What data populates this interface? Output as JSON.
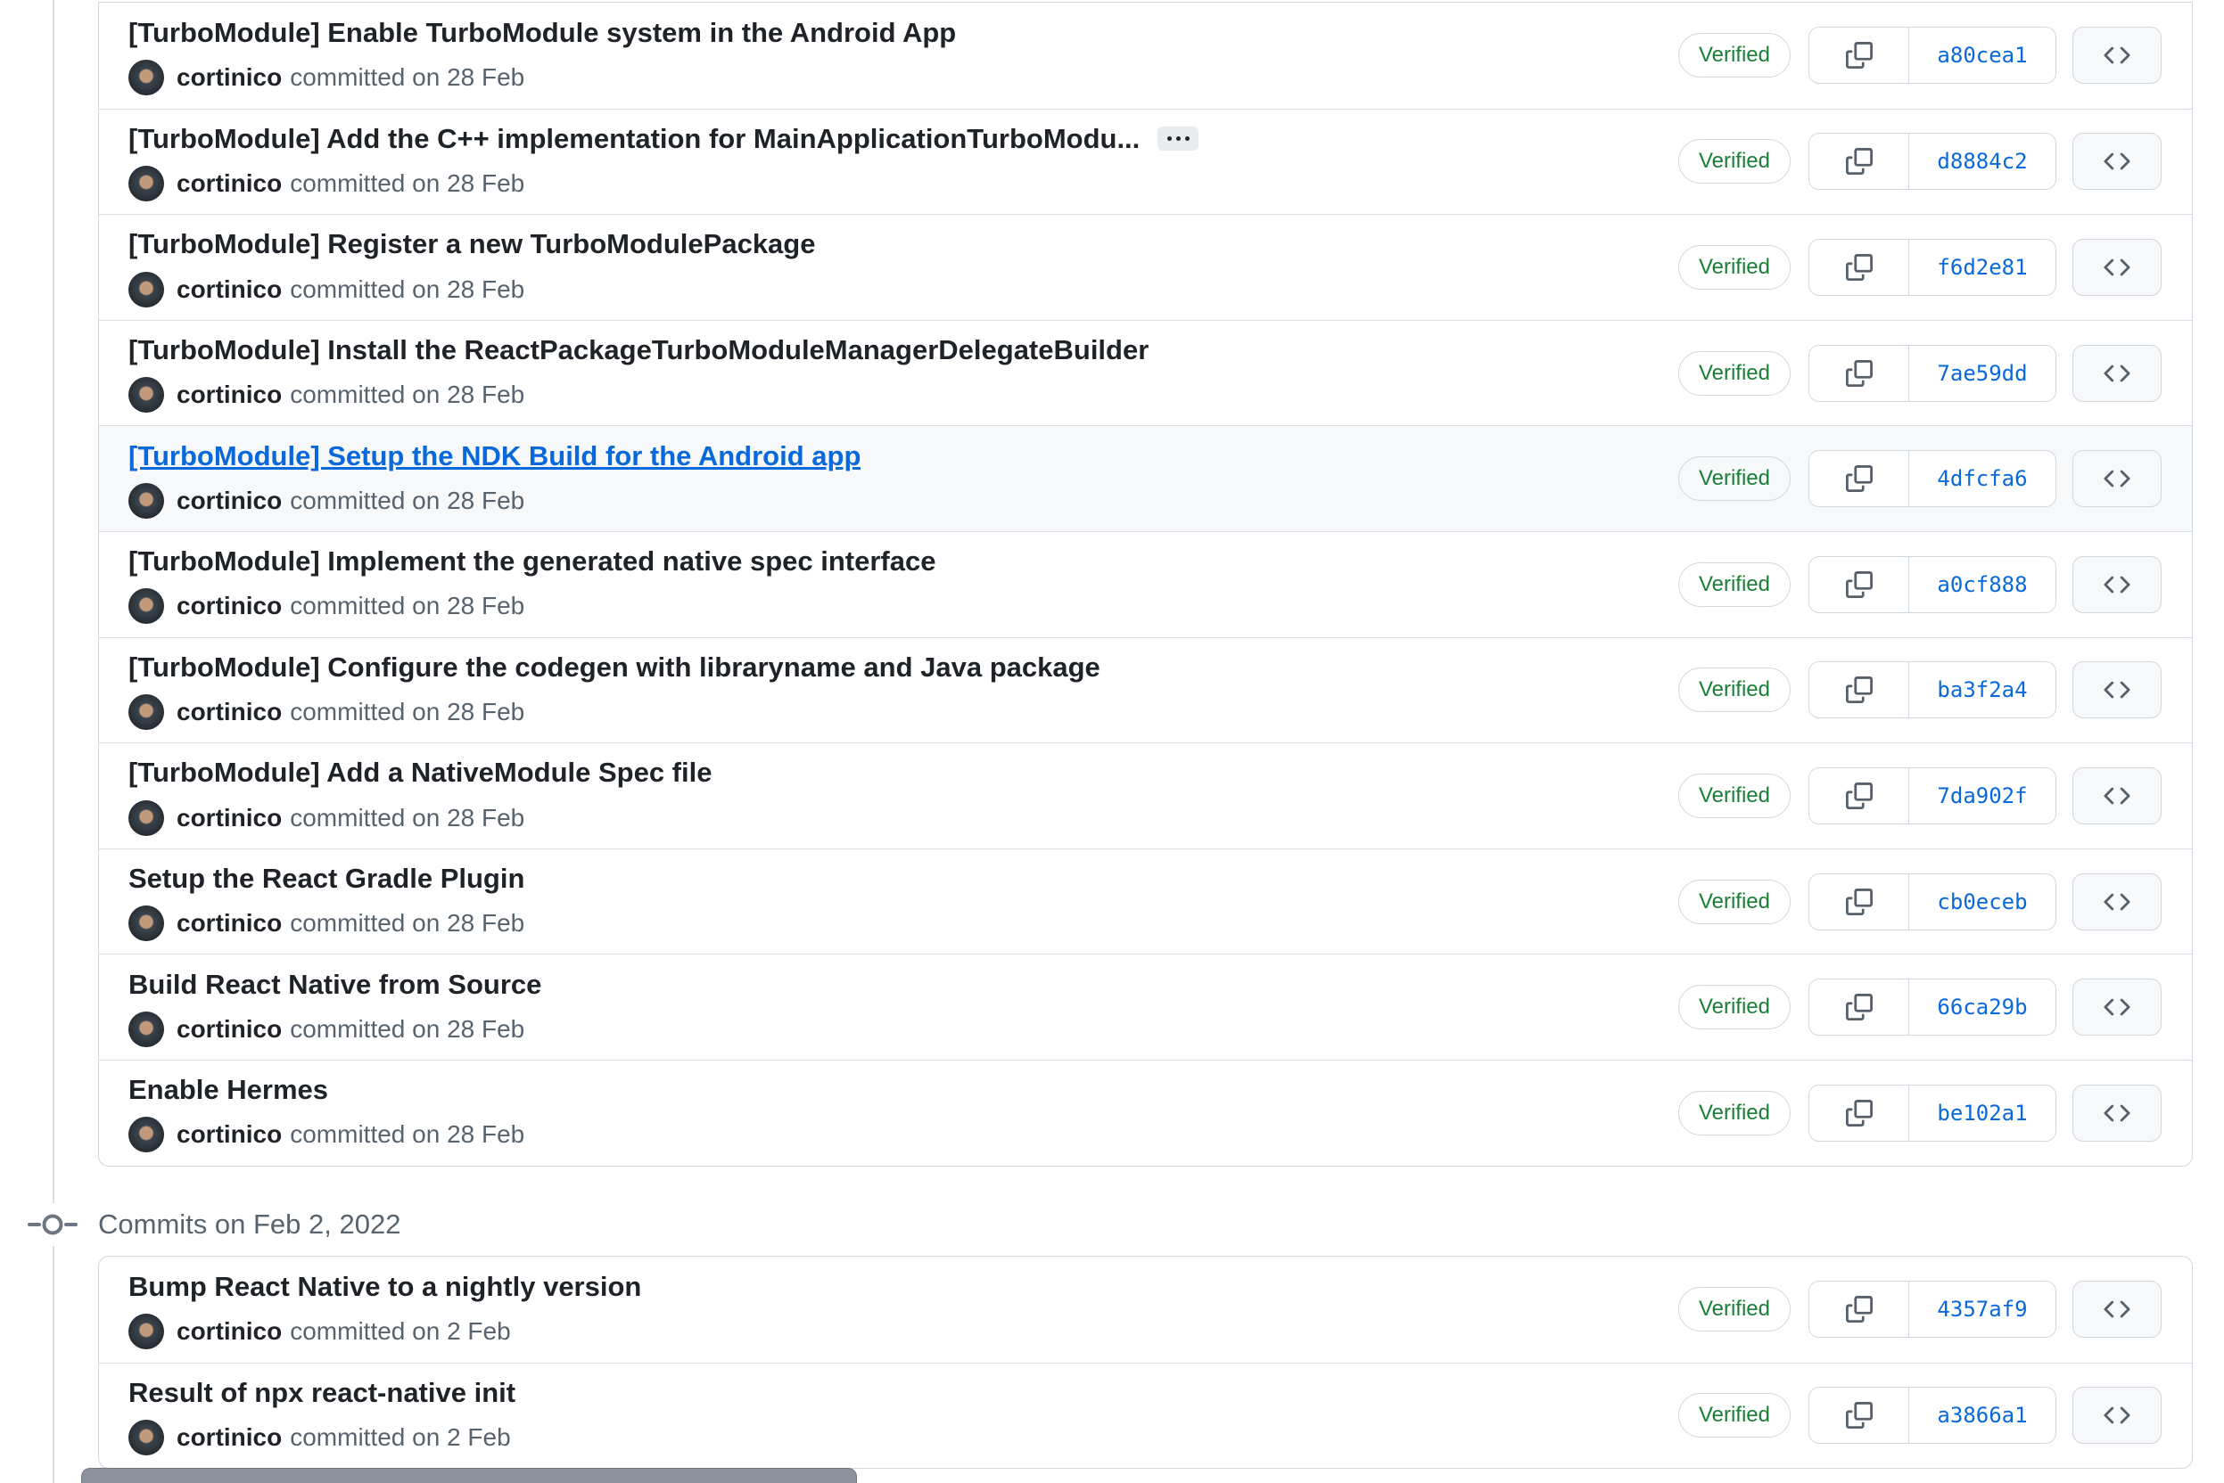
{
  "ui": {
    "verified_label": "Verified",
    "colors": {
      "link_blue": "#0969da",
      "verified_green": "#1a7f37",
      "border_gray": "#d0d7de",
      "muted_gray": "#59636e",
      "row_highlight": "#f6f8fa"
    },
    "icons": {
      "copy": "copy-icon",
      "code": "code-icon",
      "git_commit": "git-commit-icon",
      "kebab": "kebab-horizontal-icon"
    }
  },
  "sections": [
    {
      "heading": "",
      "commits": [
        {
          "title": "[TurboModule] Enable TurboModule system in the Android App",
          "author": "cortinico",
          "committed": "committed on 28 Feb",
          "hash": "a80cea1"
        },
        {
          "title": "[TurboModule] Add the C++ implementation for MainApplicationTurboModu...",
          "author": "cortinico",
          "committed": "committed on 28 Feb",
          "hash": "d8884c2"
        },
        {
          "title": "[TurboModule] Register a new TurboModulePackage",
          "author": "cortinico",
          "committed": "committed on 28 Feb",
          "hash": "f6d2e81"
        },
        {
          "title": "[TurboModule] Install the ReactPackageTurboModuleManagerDelegateBuilder",
          "author": "cortinico",
          "committed": "committed on 28 Feb",
          "hash": "7ae59dd"
        },
        {
          "title": "[TurboModule] Setup the NDK Build for the Android app",
          "author": "cortinico",
          "committed": "committed on 28 Feb",
          "hash": "4dfcfa6"
        },
        {
          "title": "[TurboModule] Implement the generated native spec interface",
          "author": "cortinico",
          "committed": "committed on 28 Feb",
          "hash": "a0cf888"
        },
        {
          "title": "[TurboModule] Configure the codegen with libraryname and Java package",
          "author": "cortinico",
          "committed": "committed on 28 Feb",
          "hash": "ba3f2a4"
        },
        {
          "title": "[TurboModule] Add a NativeModule Spec file",
          "author": "cortinico",
          "committed": "committed on 28 Feb",
          "hash": "7da902f"
        },
        {
          "title": "Setup the React Gradle Plugin",
          "author": "cortinico",
          "committed": "committed on 28 Feb",
          "hash": "cb0eceb"
        },
        {
          "title": "Build React Native from Source",
          "author": "cortinico",
          "committed": "committed on 28 Feb",
          "hash": "66ca29b"
        },
        {
          "title": "Enable Hermes",
          "author": "cortinico",
          "committed": "committed on 28 Feb",
          "hash": "be102a1"
        }
      ]
    },
    {
      "heading": "Commits on Feb 2, 2022",
      "commits": [
        {
          "title": "Bump React Native to a nightly version",
          "author": "cortinico",
          "committed": "committed on 2 Feb",
          "hash": "4357af9"
        },
        {
          "title": "Result of npx react-native init",
          "author": "cortinico",
          "committed": "committed on 2 Feb",
          "hash": "a3866a1"
        }
      ]
    }
  ]
}
